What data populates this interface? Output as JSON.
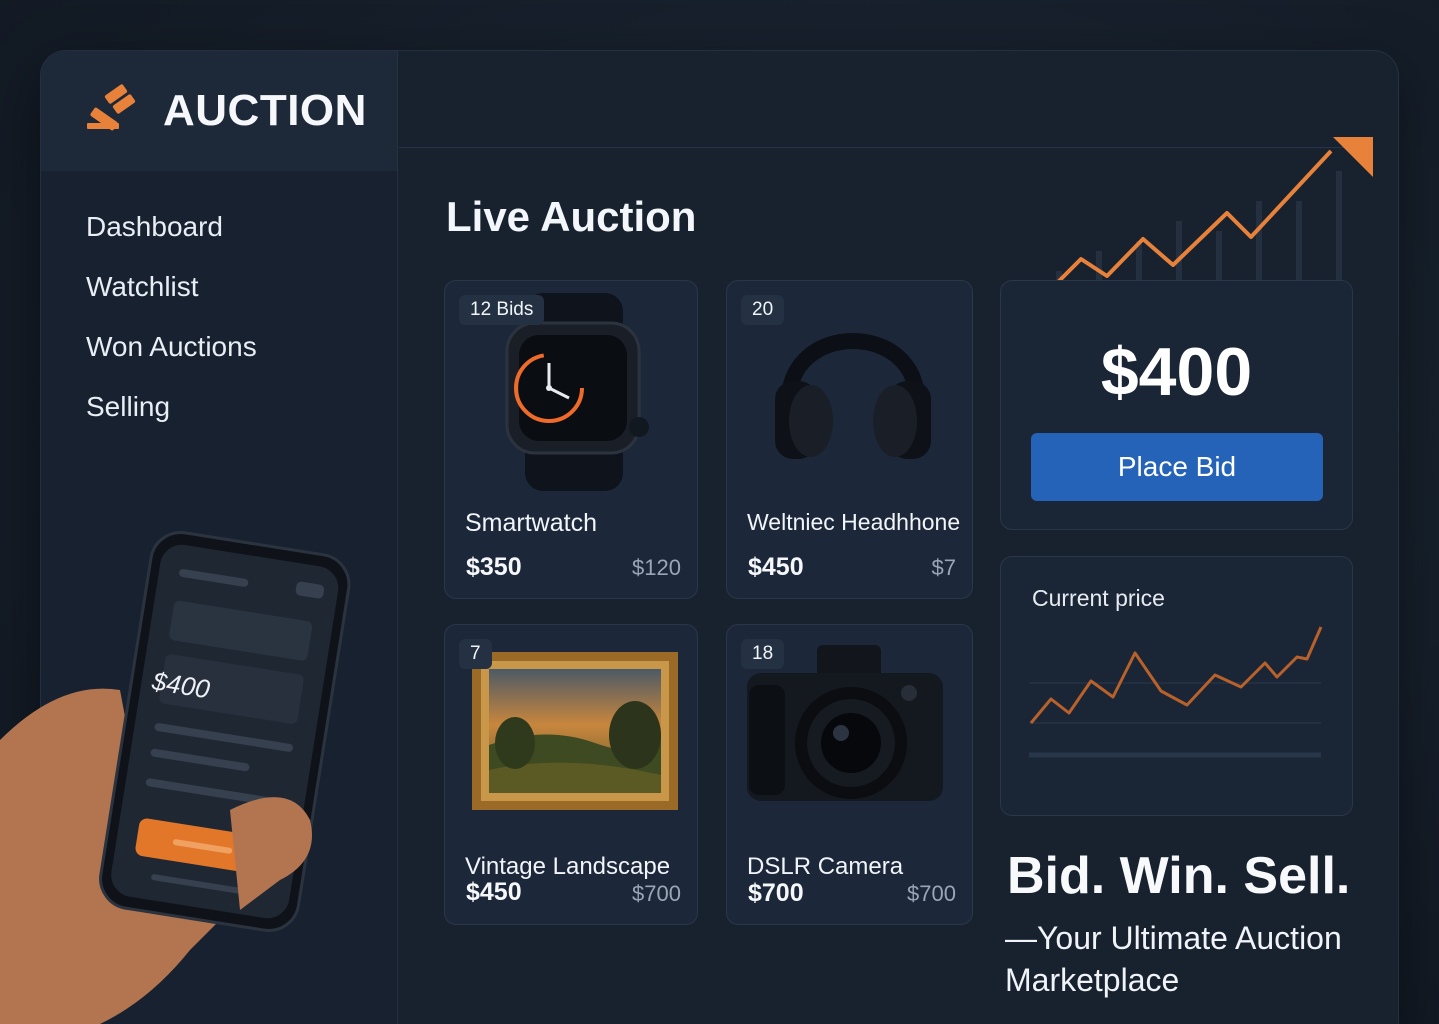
{
  "brand": {
    "name": "AUCTION",
    "icon": "gavel-icon",
    "accent": "#e8823a"
  },
  "sidebar": {
    "items": [
      {
        "label": "Dashboard"
      },
      {
        "label": "Watchlist"
      },
      {
        "label": "Won Auctions"
      },
      {
        "label": "Selling"
      }
    ]
  },
  "main": {
    "title": "Live Auction"
  },
  "cards": [
    {
      "badge": "12 Bids",
      "name": "Smartwatch",
      "price": "$350",
      "sub": "$120",
      "icon": "smartwatch-icon"
    },
    {
      "badge": "20",
      "name": "Weltniec Headhhone",
      "price": "$450",
      "sub": "$7",
      "icon": "headphones-icon"
    },
    {
      "badge": "7",
      "name": "Vintage Landscape",
      "price": "$450",
      "sub": "$700",
      "icon": "painting-icon"
    },
    {
      "badge": "18",
      "name": "DSLR Camera",
      "price": "$700",
      "sub": "$700",
      "icon": "camera-icon"
    }
  ],
  "bid_panel": {
    "price": "$400",
    "button_label": "Place Bid",
    "button_color": "#2563b8"
  },
  "price_panel": {
    "label": "Current price"
  },
  "phone": {
    "price": "$400",
    "button_color": "#e2772a"
  },
  "tagline": {
    "headline": "Bid. Win. Sell.",
    "subline": "—Your Ultimate Auction Marketplace"
  }
}
